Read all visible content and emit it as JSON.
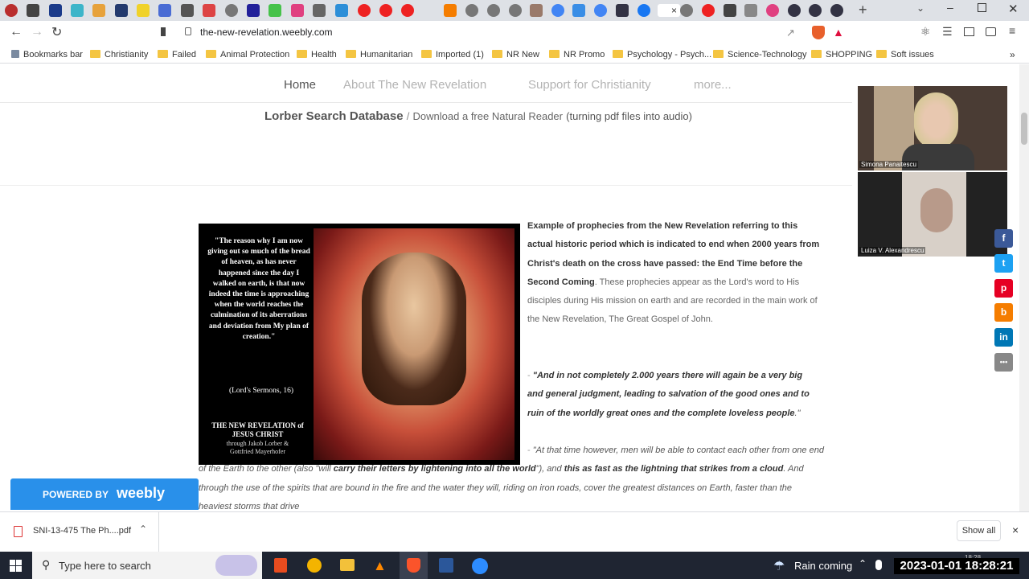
{
  "browser": {
    "url": "the-new-revelation.weebly.com",
    "bookmarks": [
      {
        "label": "Bookmarks bar"
      },
      {
        "label": "Christianity"
      },
      {
        "label": "Failed"
      },
      {
        "label": "Animal Protection"
      },
      {
        "label": "Health"
      },
      {
        "label": "Humanitarian"
      },
      {
        "label": "Imported (1)"
      },
      {
        "label": "NR New"
      },
      {
        "label": "NR Promo"
      },
      {
        "label": "Psychology - Psych..."
      },
      {
        "label": "Science-Technology"
      },
      {
        "label": "SHOPPING"
      },
      {
        "label": "Soft issues"
      }
    ],
    "active_tab_close": "×"
  },
  "site": {
    "nav": {
      "home": "Home",
      "about": "About The New Revelation",
      "support": "Support for Christianity",
      "more": "more..."
    },
    "sublinks": {
      "lorber": "Lorber Search Database",
      "separator": "/",
      "download_prefix": "Download a free Natural Reader",
      "download_suffix": "(turning pdf files into audio)"
    },
    "image": {
      "quote": "\"The reason why I am now giving out so much of the bread of heaven, as has never happened since the day I walked on earth, is that now indeed the time is approaching when the world reaches the culmination of its aberrations and deviation from My plan of creation.\"",
      "citation": "(Lord's Sermons, 16)",
      "brand_line1": "THE NEW REVELATION of",
      "brand_line2": "JESUS CHRIST",
      "brand_line3": "through Jakob Lorber &",
      "brand_line4": "Gottfried Mayerhofer"
    },
    "paragraph1_bold": "Example of prophecies from the New Revelation referring to this actual historic period which is indicated to end when 2000 years from Christ's death on the cross have passed: the End Time before the Second Coming",
    "paragraph1_rest": ". These prophecies appear as the Lord's word to His disciples during His mission on earth and are recorded in the main work of the New Revelation, The Great Gospel of John.",
    "quote1_dash": "- ",
    "quote1_bold": "\"And in not completely 2.000 years there will again be a very big and general judgment, leading to salvation of the good ones and to ruin of the worldly great ones and the complete loveless people",
    "quote1_end": ".\"",
    "quote2_dash": "- ",
    "quote2_a": "\"At that time however, men will be able to contact each other from one end of the Earth to the other (also \"will ",
    "quote2_b": "carry their letters by lightening into all the world",
    "quote2_c": "\"), and ",
    "quote2_d": "this as fast as the lightning that strikes from a cloud",
    "quote2_e": ". And through the use of the spirits that are bound in the fire and the water they will, riding on iron roads, cover the greatest distances on Earth, faster than the heaviest storms that drive"
  },
  "weebly": {
    "powered_by": "POWERED BY",
    "brand": "weebly"
  },
  "video": {
    "participant1": "Simona Panaitescu",
    "participant2": "Luiza V. Alexandrescu"
  },
  "social": [
    "f",
    "t",
    "p",
    "b",
    "in",
    "•••"
  ],
  "download": {
    "file": "SNI-13-475 The Ph....pdf",
    "show_all": "Show all",
    "close": "×"
  },
  "taskbar": {
    "search_placeholder": "Type here to search",
    "weather": "Rain coming",
    "datetime": "2023-01-01 18:28:21",
    "clock_small": "18:28"
  },
  "colors": {
    "accent_facebook": "#3b5998",
    "accent_twitter": "#1da1f2",
    "accent_pinterest": "#e60023",
    "accent_blogger": "#f57d00",
    "accent_linkedin": "#0077b5",
    "weebly_blue": "#2990ea"
  }
}
